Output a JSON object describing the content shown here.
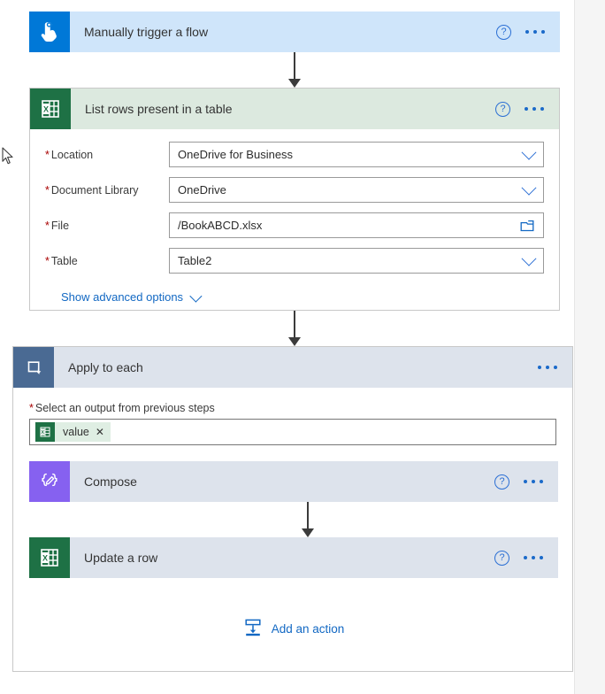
{
  "flow": {
    "trigger": {
      "title": "Manually trigger a flow",
      "icon": "hand-tap-icon",
      "help_icon": "help-icon",
      "more_icon": "ellipsis-icon",
      "accent": "#0078d7",
      "header_bg": "#cfe5fa"
    },
    "list_rows": {
      "title": "List rows present in a table",
      "icon": "excel-icon",
      "help_icon": "help-icon",
      "more_icon": "ellipsis-icon",
      "accent": "#1e7145",
      "header_bg": "#dce9df",
      "fields": [
        {
          "label": "Location",
          "required": true,
          "value": "OneDrive for Business",
          "affix": "chevron-down-icon"
        },
        {
          "label": "Document Library",
          "required": true,
          "value": "OneDrive",
          "affix": "chevron-down-icon"
        },
        {
          "label": "File",
          "required": true,
          "value": "/BookABCD.xlsx",
          "affix": "folder-picker-icon"
        },
        {
          "label": "Table",
          "required": true,
          "value": "Table2",
          "affix": "chevron-down-icon"
        }
      ],
      "advanced_options_label": "Show advanced options"
    },
    "apply_to_each": {
      "title": "Apply to each",
      "icon": "loop-icon",
      "more_icon": "ellipsis-icon",
      "accent": "#4a6a93",
      "header_bg": "#dde3ec",
      "output_field": {
        "label": "Select an output from previous steps",
        "required": true,
        "token": {
          "label": "value",
          "icon": "excel-icon",
          "remove_icon": "close-icon",
          "remove_glyph": "✕"
        }
      },
      "children": {
        "compose": {
          "title": "Compose",
          "icon": "compose-braces-icon",
          "help_icon": "help-icon",
          "more_icon": "ellipsis-icon",
          "accent": "#8661f0",
          "header_bg": "#eae6fd"
        },
        "update_row": {
          "title": "Update a row",
          "icon": "excel-icon",
          "help_icon": "help-icon",
          "more_icon": "ellipsis-icon",
          "accent": "#1e7145",
          "header_bg": "#dce9df"
        }
      },
      "add_action": {
        "label": "Add an action",
        "icon": "add-action-icon"
      }
    },
    "required_marker": "*",
    "help_glyph": "?",
    "link_color": "#1268c3"
  }
}
